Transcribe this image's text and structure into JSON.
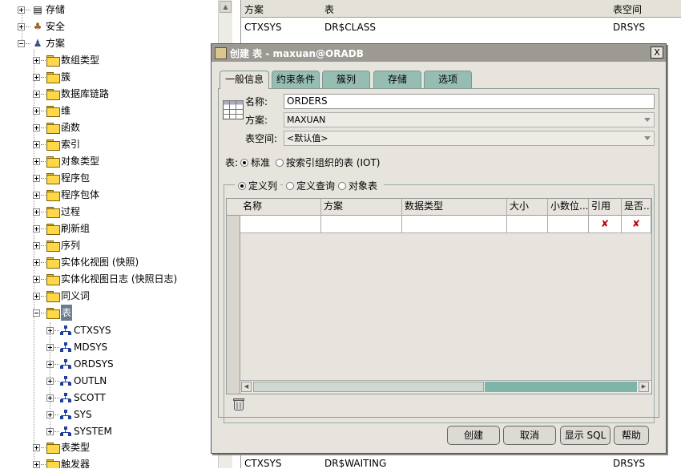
{
  "tree": {
    "storage": "存储",
    "security": "安全",
    "schema": "方案",
    "folders": [
      "数组类型",
      "簇",
      "数据库链路",
      "维",
      "函数",
      "索引",
      "对象类型",
      "程序包",
      "程序包体",
      "过程",
      "刷新组",
      "序列",
      "实体化视图 (快照)",
      "实体化视图日志 (快照日志)",
      "同义词"
    ],
    "tables_node": "表",
    "schemas": [
      "CTXSYS",
      "MDSYS",
      "ORDSYS",
      "OUTLN",
      "SCOTT",
      "SYS",
      "SYSTEM"
    ],
    "after": [
      "表类型",
      "触发器"
    ]
  },
  "background_table": {
    "columns": [
      "方案",
      "表",
      "表空间"
    ],
    "rows": [
      [
        "CTXSYS",
        "DR$CLASS",
        "DRSYS"
      ],
      [
        "CTXSYS",
        "DR$WAITING",
        "DRSYS"
      ]
    ]
  },
  "dialog": {
    "title": "创建 表 - maxuan@ORADB",
    "close_label": "X",
    "tabs": [
      "一般信息",
      "约束条件",
      "簇列",
      "存储",
      "选项"
    ],
    "name_label": "名称:",
    "name_value": "ORDERS",
    "schema_label": "方案:",
    "schema_value": "MAXUAN",
    "tablespace_label": "表空间:",
    "tablespace_value": "<默认值>",
    "table_label": "表:",
    "table_type_options": [
      "标准",
      "按索引组织的表 (IOT)"
    ],
    "column_mode_options": [
      "定义列",
      "定义查询",
      "对象表"
    ],
    "grid_columns": [
      "名称",
      "方案",
      "数据类型",
      "大小",
      "小数位...",
      "引用",
      "是否..."
    ],
    "buttons": {
      "create": "创建",
      "cancel": "取消",
      "show_sql": "显示 SQL",
      "help": "帮助"
    }
  }
}
